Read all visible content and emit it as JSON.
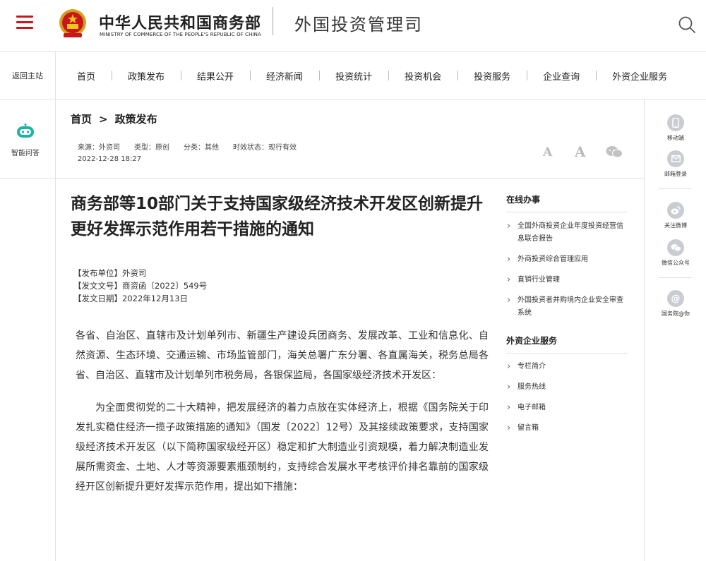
{
  "header": {
    "site_name_cn": "中华人民共和国商务部",
    "site_name_en": "MINISTRY OF COMMERCE OF THE PEOPLE'S REPUBLIC OF CHINA",
    "department": "外国投资管理司"
  },
  "nav": {
    "back": "返回主站",
    "items": [
      "首页",
      "政策发布",
      "结果公开",
      "经济新闻",
      "投资统计",
      "投资机会",
      "投资服务",
      "企业查询",
      "外资企业服务"
    ]
  },
  "left_sidebar": {
    "assistant": "智能问答"
  },
  "right_sidebar": {
    "items": [
      "移动端",
      "邮箱登录",
      "关注微博",
      "微信公众号",
      "国务院@你"
    ]
  },
  "breadcrumb": {
    "home": "首页",
    "separator": ">",
    "current": "政策发布"
  },
  "meta": {
    "source": "来源：外资司",
    "type": "类型：原创",
    "category": "分类：其他",
    "status": "时效状态：现行有效",
    "date": "2022-12-28 18:27"
  },
  "tools": {
    "font_small": "A",
    "font_large": "A"
  },
  "article": {
    "title": "商务部等10部门关于支持国家级经济技术开发区创新提升更好发挥示范作用若干措施的通知",
    "issuer": "【发布单位】外资司",
    "doc_no": "【发文文号】商资函〔2022〕549号",
    "issue_date": "【发文日期】2022年12月13日",
    "para1": "各省、自治区、直辖市及计划单列市、新疆生产建设兵团商务、发展改革、工业和信息化、自然资源、生态环境、交通运输、市场监管部门，海关总署广东分署、各直属海关，税务总局各省、自治区、直辖市及计划单列市税务局，各银保监局，各国家级经济技术开发区：",
    "para2": "为全面贯彻党的二十大精神，把发展经济的着力点放在实体经济上，根据《国务院关于印发扎实稳住经济一揽子政策措施的通知》（国发〔2022〕12号）及其接续政策要求，支持国家级经济技术开发区（以下简称国家级经开区）稳定和扩大制造业引资规模，着力解决制造业发展所需资金、土地、人才等资源要素瓶颈制约，支持综合发展水平考核评价排名靠前的国家级经开区创新提升更好发挥示范作用，提出如下措施："
  },
  "online_service": {
    "title": "在线办事",
    "items": [
      "全国外商投资企业年度投资经营信息联合报告",
      "外商投资综合管理应用",
      "直销行业管理",
      "外国投资者并购境内企业安全审查系统"
    ]
  },
  "enterprise_service": {
    "title": "外资企业服务",
    "items": [
      "专栏简介",
      "服务热线",
      "电子邮箱",
      "留言箱"
    ]
  },
  "colors": {
    "accent_red": "#c8161d",
    "icon_gray": "#c9cdd2",
    "robot_teal": "#19b5a5"
  }
}
